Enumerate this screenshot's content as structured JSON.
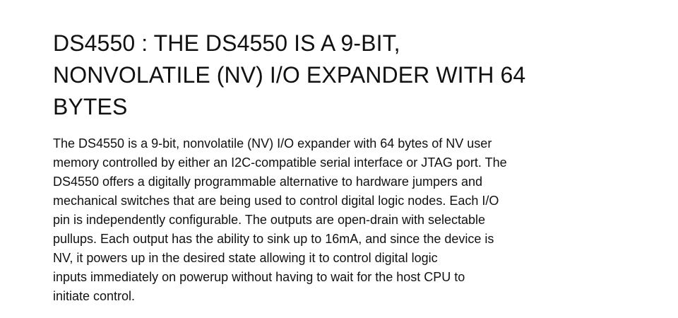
{
  "title_lines": [
    "DS4550 : THE DS4550 IS A 9-BIT,",
    "NONVOLATILE (NV) I/O EXPANDER WITH 64",
    "BYTES"
  ],
  "description_lines": [
    "The DS4550 is a 9-bit, nonvolatile (NV) I/O expander with 64 bytes of NV user",
    "memory controlled by either an I2C-compatible serial interface or JTAG port. The",
    "DS4550 offers a digitally programmable alternative to hardware jumpers and",
    "mechanical switches that are being used to control digital logic nodes. Each I/O",
    "pin is independently configurable. The outputs are open-drain with selectable",
    "pullups. Each output has the ability to sink up to 16mA, and since the device is",
    "NV, it powers up in the desired state allowing it to control digital logic",
    "inputs immediately on powerup without having to wait for the host CPU to",
    "initiate control."
  ]
}
